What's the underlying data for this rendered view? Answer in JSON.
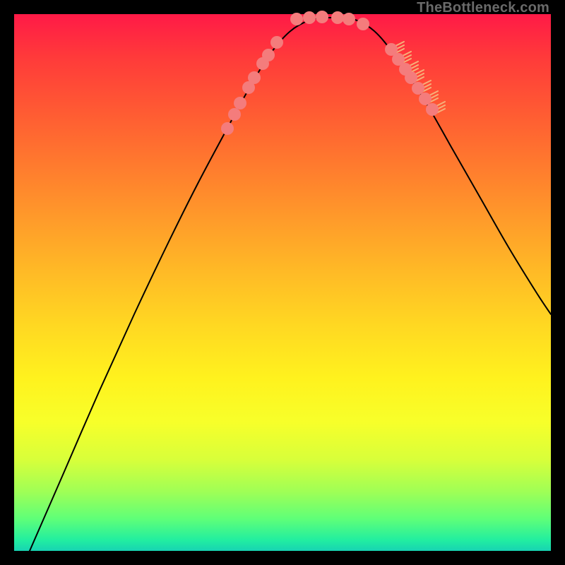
{
  "watermark": "TheBottleneck.com",
  "chart_data": {
    "type": "line",
    "title": "",
    "xlabel": "",
    "ylabel": "",
    "xlim": [
      0,
      760
    ],
    "ylim": [
      0,
      760
    ],
    "series": [
      {
        "name": "curve",
        "x": [
          22,
          70,
          120,
          170,
          220,
          260,
          300,
          330,
          360,
          390,
          420,
          450,
          480,
          510,
          540,
          580,
          620,
          660,
          700,
          740,
          760
        ],
        "y": [
          0,
          110,
          225,
          335,
          440,
          520,
          595,
          650,
          700,
          735,
          752,
          755,
          753,
          736,
          700,
          640,
          570,
          500,
          430,
          365,
          335
        ]
      }
    ],
    "dot_clusters": [
      {
        "name": "left-cluster",
        "points": [
          [
            302,
            598
          ],
          [
            312,
            618
          ],
          [
            320,
            634
          ],
          [
            332,
            656
          ],
          [
            340,
            670
          ],
          [
            352,
            690
          ],
          [
            360,
            702
          ],
          [
            372,
            720
          ]
        ]
      },
      {
        "name": "bottom-cluster",
        "points": [
          [
            400,
            753
          ],
          [
            418,
            755
          ],
          [
            436,
            756
          ],
          [
            458,
            755
          ],
          [
            474,
            753
          ],
          [
            494,
            746
          ]
        ]
      },
      {
        "name": "right-cluster",
        "points": [
          [
            534,
            710
          ],
          [
            544,
            696
          ],
          [
            554,
            682
          ],
          [
            562,
            670
          ],
          [
            572,
            655
          ],
          [
            582,
            640
          ],
          [
            592,
            625
          ]
        ]
      }
    ],
    "right_ticks": {
      "points": [
        [
          534,
          710
        ],
        [
          544,
          696
        ],
        [
          554,
          682
        ],
        [
          562,
          670
        ],
        [
          572,
          655
        ],
        [
          582,
          640
        ],
        [
          592,
          625
        ]
      ]
    },
    "colors": {
      "curve": "#000000",
      "dots": "#f47c7c",
      "ticks": "#f6b07a"
    }
  }
}
